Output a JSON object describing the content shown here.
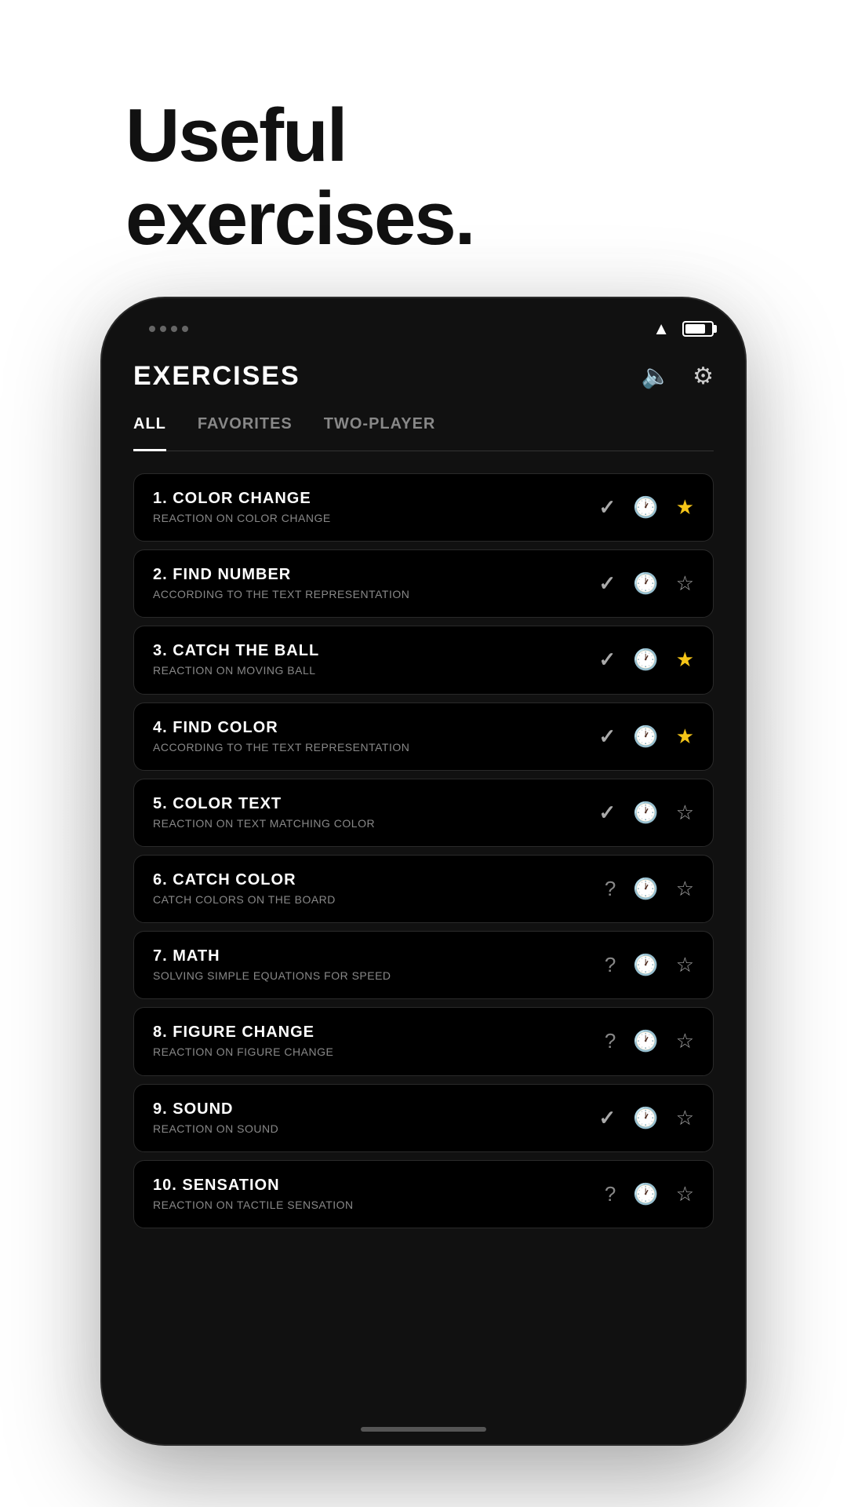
{
  "hero": {
    "line1": "Useful",
    "line2": "exercises."
  },
  "header": {
    "title": "EXERCISES",
    "sound_icon": "🔈",
    "settings_icon": "⚙"
  },
  "tabs": [
    {
      "label": "ALL",
      "active": true
    },
    {
      "label": "FAVORITES",
      "active": false
    },
    {
      "label": "TWO-PLAYER",
      "active": false
    }
  ],
  "exercises": [
    {
      "number": "1.",
      "name": "COLOR CHANGE",
      "subtitle": "REACTION ON COLOR CHANGE",
      "status": "check",
      "favorited": true
    },
    {
      "number": "2.",
      "name": "FIND NUMBER",
      "subtitle": "ACCORDING TO THE TEXT REPRESENTATION",
      "status": "check",
      "favorited": false
    },
    {
      "number": "3.",
      "name": "CATCH THE BALL",
      "subtitle": "REACTION ON MOVING BALL",
      "status": "check",
      "favorited": true
    },
    {
      "number": "4.",
      "name": "FIND COLOR",
      "subtitle": "ACCORDING TO THE TEXT REPRESENTATION",
      "status": "check",
      "favorited": true
    },
    {
      "number": "5.",
      "name": "COLOR TEXT",
      "subtitle": "REACTION ON TEXT MATCHING COLOR",
      "status": "check",
      "favorited": false
    },
    {
      "number": "6.",
      "name": "CATCH COLOR",
      "subtitle": "CATCH COLORS ON THE BOARD",
      "status": "question",
      "favorited": false
    },
    {
      "number": "7.",
      "name": "MATH",
      "subtitle": "SOLVING SIMPLE EQUATIONS FOR SPEED",
      "status": "question",
      "favorited": false
    },
    {
      "number": "8.",
      "name": "FIGURE CHANGE",
      "subtitle": "REACTION ON FIGURE CHANGE",
      "status": "question",
      "favorited": false
    },
    {
      "number": "9.",
      "name": "SOUND",
      "subtitle": "REACTION ON SOUND",
      "status": "check",
      "favorited": false
    },
    {
      "number": "10.",
      "name": "SENSATION",
      "subtitle": "REACTION ON TACTILE SENSATION",
      "status": "question",
      "favorited": false
    }
  ],
  "colors": {
    "star_filled": "#f5c518",
    "star_empty": "#aaaaaa",
    "check": "#aaaaaa",
    "question": "#888888"
  }
}
